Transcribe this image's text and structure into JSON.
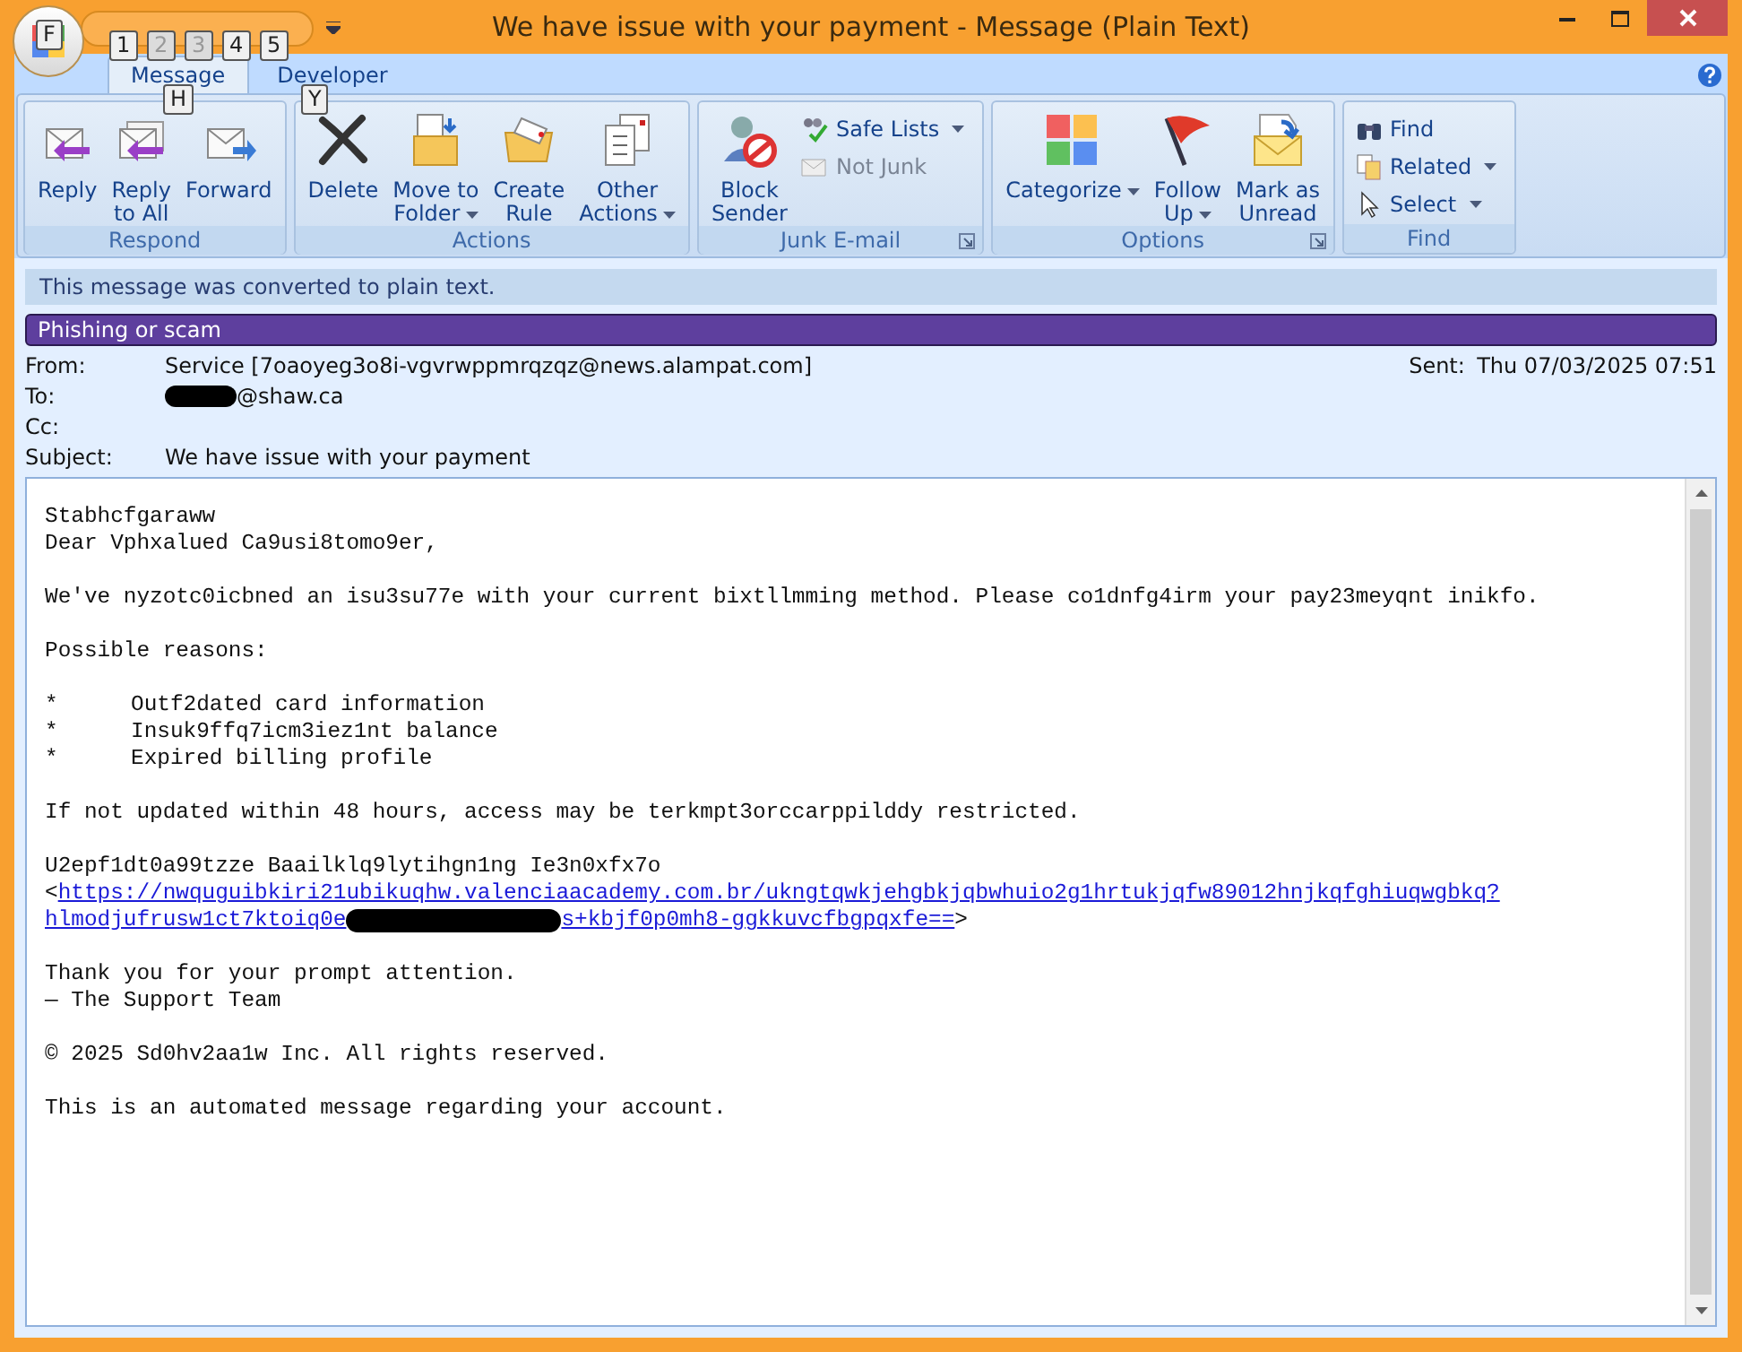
{
  "window": {
    "title": "We have issue with your payment - Message (Plain Text)"
  },
  "office_button": {
    "keytip": "F"
  },
  "quick_access": [
    {
      "keytip": "1",
      "disabled": false
    },
    {
      "keytip": "2",
      "disabled": true
    },
    {
      "keytip": "3",
      "disabled": true
    },
    {
      "keytip": "4",
      "disabled": false
    },
    {
      "keytip": "5",
      "disabled": false
    }
  ],
  "tabs": [
    {
      "label": "Message",
      "selected": true,
      "keytip": "H"
    },
    {
      "label": "Developer",
      "selected": false,
      "keytip": "Y"
    }
  ],
  "ribbon_groups": [
    {
      "label": "Respond",
      "launcher": false,
      "buttons": [
        {
          "kind": "large",
          "lines": [
            "Reply"
          ],
          "dropdown": false,
          "disabled": false
        },
        {
          "kind": "large",
          "lines": [
            "Reply",
            "to All"
          ],
          "dropdown": false,
          "disabled": false
        },
        {
          "kind": "large",
          "lines": [
            "Forward"
          ],
          "dropdown": false,
          "disabled": false
        }
      ]
    },
    {
      "label": "Actions",
      "launcher": false,
      "buttons": [
        {
          "kind": "large",
          "lines": [
            "Delete"
          ],
          "dropdown": false,
          "disabled": false
        },
        {
          "kind": "large",
          "lines": [
            "Move to",
            "Folder"
          ],
          "dropdown": true,
          "disabled": false
        },
        {
          "kind": "large",
          "lines": [
            "Create",
            "Rule"
          ],
          "dropdown": false,
          "disabled": false
        },
        {
          "kind": "large",
          "lines": [
            "Other",
            "Actions"
          ],
          "dropdown": true,
          "disabled": false
        }
      ]
    },
    {
      "label": "Junk E-mail",
      "launcher": true,
      "buttons": [
        {
          "kind": "large",
          "lines": [
            "Block",
            "Sender"
          ],
          "dropdown": false,
          "disabled": false
        },
        {
          "kind": "small",
          "lines": [
            "Safe Lists"
          ],
          "dropdown": true,
          "disabled": false
        },
        {
          "kind": "small",
          "lines": [
            "Not Junk"
          ],
          "dropdown": false,
          "disabled": true
        }
      ]
    },
    {
      "label": "Options",
      "launcher": true,
      "buttons": [
        {
          "kind": "large",
          "lines": [
            "Categorize"
          ],
          "dropdown": true,
          "disabled": false
        },
        {
          "kind": "large",
          "lines": [
            "Follow",
            "Up"
          ],
          "dropdown": true,
          "disabled": false
        },
        {
          "kind": "large",
          "lines": [
            "Mark as",
            "Unread"
          ],
          "dropdown": false,
          "disabled": false
        }
      ]
    },
    {
      "label": "Find",
      "launcher": false,
      "buttons": [
        {
          "kind": "small",
          "lines": [
            "Find"
          ],
          "dropdown": false,
          "disabled": false
        },
        {
          "kind": "small",
          "lines": [
            "Related"
          ],
          "dropdown": true,
          "disabled": false
        },
        {
          "kind": "small",
          "lines": [
            "Select"
          ],
          "dropdown": true,
          "disabled": false
        }
      ]
    }
  ],
  "info_bar": "This message was converted to plain text.",
  "category_bar": {
    "label": "Phishing or scam",
    "color": "#5e3f9e"
  },
  "header": {
    "from_label": "From:",
    "from": "Service [7oaoyeg3o8i-vgvrwppmrqzqz@news.alampat.com]",
    "sent_label": "Sent:",
    "sent": "Thu 07/03/2025 07:51",
    "to_label": "To:",
    "to_visible": "@shaw.ca",
    "cc_label": "Cc:",
    "subject_label": "Subject:",
    "subject": "We have issue with your payment"
  },
  "body": [
    {
      "kind": "text",
      "text": "Stabhcfgaraww"
    },
    {
      "kind": "text",
      "text": "Dear Vphxalued Ca9usi8tomo9er,"
    },
    {
      "kind": "blank"
    },
    {
      "kind": "text",
      "text": "We've nyzotc0icbned an isu3su77e with your current bixtllmming method. Please co1dnfg4irm your pay23meyqnt inikfo."
    },
    {
      "kind": "blank"
    },
    {
      "kind": "text",
      "text": "Possible reasons:"
    },
    {
      "kind": "blank"
    },
    {
      "kind": "bullet",
      "marker": "*",
      "text": "Outf2dated card information"
    },
    {
      "kind": "bullet",
      "marker": "*",
      "text": "Insuk9ffq7icm3iez1nt balance"
    },
    {
      "kind": "bullet",
      "marker": "*",
      "text": "Expired billing profile"
    },
    {
      "kind": "blank"
    },
    {
      "kind": "text",
      "text": "If not updated within 48 hours, access may be terkmpt3orccarppilddy restricted."
    },
    {
      "kind": "blank"
    },
    {
      "kind": "text",
      "text": "U2epf1dt0a99tzze Baailklq9lytihgn1ng Ie3n0xfx7o"
    },
    {
      "kind": "link",
      "open": "<",
      "text": "https://nwquguibkiri21ubikuqhw.valenciaacademy.com.br/ukngtqwkjehgbkjqbwhuio2g1hrtukjqfw89012hnjkqfghiuqwgbkq?"
    },
    {
      "kind": "redacted_link",
      "before": "hlmodjufrusw1ct7ktoiq0e",
      "after": "s+kbjf0p0mh8-ggkkuvcfbgpqxfe==",
      "close": ">"
    },
    {
      "kind": "blank"
    },
    {
      "kind": "text",
      "text": "Thank you for your prompt attention."
    },
    {
      "kind": "text",
      "text": "— The Support Team"
    },
    {
      "kind": "blank"
    },
    {
      "kind": "text",
      "text": "© 2025 Sd0hv2aa1w Inc. All rights reserved."
    },
    {
      "kind": "blank"
    },
    {
      "kind": "text",
      "text": "This is an automated message regarding your account."
    }
  ]
}
